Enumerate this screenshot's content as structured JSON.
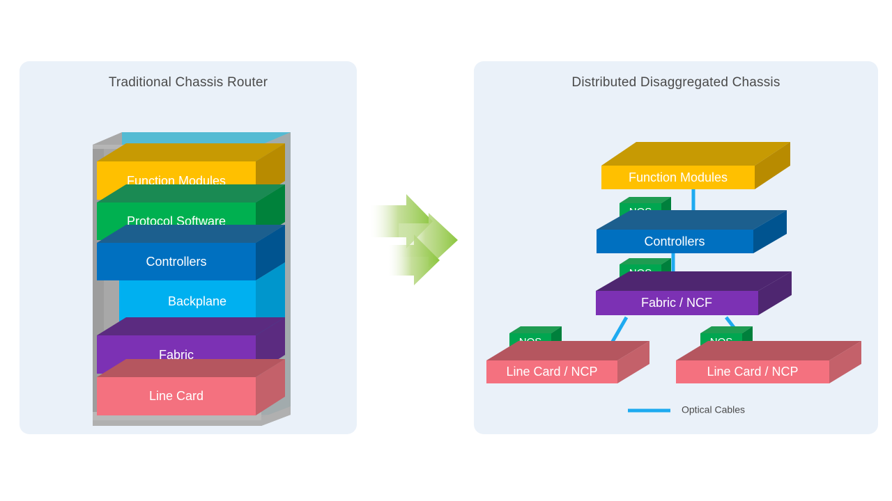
{
  "page": {
    "background": "#ffffff",
    "panel_background": "#eaf1f9",
    "title_color": "#4a4a4a"
  },
  "left_panel": {
    "title": "Traditional Chassis Router",
    "chassis_color": "#a6a6a6",
    "backplane_frame_color": "#00b0f0",
    "layers": [
      {
        "label": "Function Modules",
        "color": "#ffc000",
        "top_color": "#c79a03",
        "side_color": "#b88b00"
      },
      {
        "label": "Protocol Software",
        "color": "#00b050",
        "top_color": "#1a8a53",
        "side_color": "#00823b"
      },
      {
        "label": "Controllers",
        "color": "#0070c0",
        "top_color": "#1c5f8e",
        "side_color": "#005490"
      },
      {
        "label": "Backplane",
        "color": "#00b0f0",
        "top_color": "#0096cc",
        "side_color": "#0096cc"
      },
      {
        "label": "Fabric",
        "color": "#7c31b4",
        "top_color": "#5b2b80",
        "side_color": "#5b2b80"
      },
      {
        "label": "Line Card",
        "color": "#f4717f",
        "top_color": "#b5565f",
        "side_color": "#c4616a"
      }
    ]
  },
  "arrows": {
    "name": "transformation-arrows",
    "count": 3,
    "color_start": "#ffffff",
    "color_end": "#8cc63f"
  },
  "right_panel": {
    "title": "Distributed Disaggregated Chassis",
    "nodes": [
      {
        "label": "Function Modules",
        "color": "#ffc000",
        "top_color": "#c79a03",
        "side_color": "#b88b00",
        "has_nos": false
      },
      {
        "label": "Controllers",
        "color": "#0070c0",
        "top_color": "#1c5f8e",
        "side_color": "#005490",
        "has_nos": true
      },
      {
        "label": "Fabric / NCF",
        "color": "#7c31b4",
        "top_color": "#4e2670",
        "side_color": "#4e2670",
        "has_nos": true
      },
      {
        "label": "Line Card / NCP",
        "color": "#f4717f",
        "top_color": "#b5565f",
        "side_color": "#c4616a",
        "has_nos": true
      },
      {
        "label": "Line Card / NCP",
        "color": "#f4717f",
        "top_color": "#b5565f",
        "side_color": "#c4616a",
        "has_nos": true
      }
    ],
    "nos_box": {
      "label": "NOS",
      "color": "#00a650",
      "top_color": "#1f9c52",
      "side_color": "#00803c"
    },
    "legend": {
      "label": "Optical Cables",
      "line_color": "#1eaaf0"
    }
  }
}
